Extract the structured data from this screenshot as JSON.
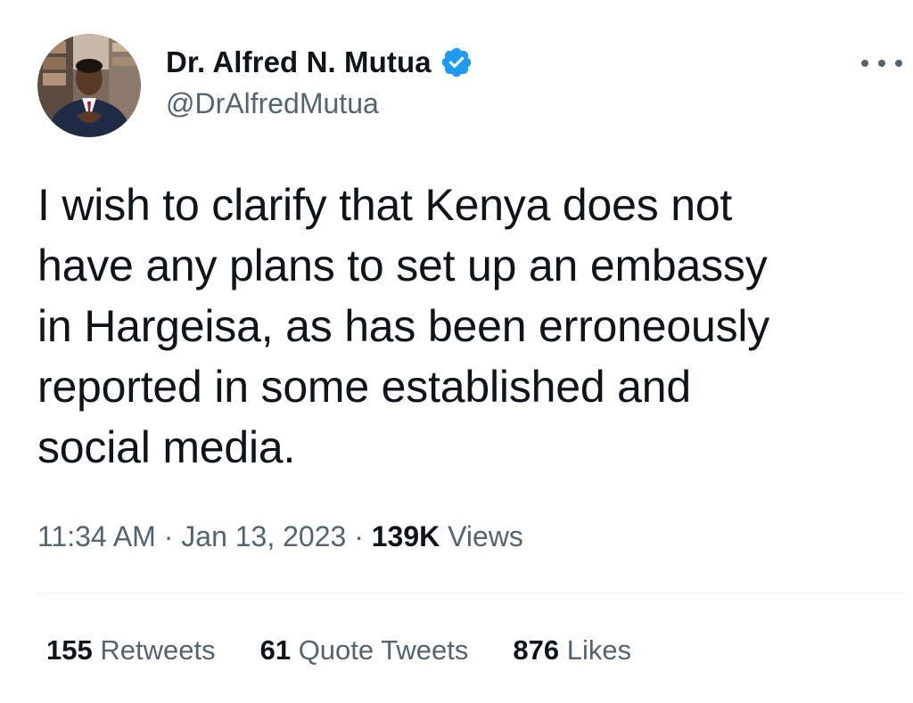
{
  "author": {
    "display_name": "Dr. Alfred N. Mutua",
    "handle": "@DrAlfredMutua",
    "verified": true,
    "avatar_icon": "profile-photo-icon"
  },
  "tweet": {
    "text": "I wish to clarify that Kenya does not\nhave any plans to set up an embassy\nin Hargeisa, as has been erroneously\nreported in some established and\nsocial media."
  },
  "meta": {
    "time": "11:34 AM",
    "date": "Jan 13, 2023",
    "separator": "·",
    "views_count": "139K",
    "views_label": "Views"
  },
  "stats": {
    "retweets_count": "155",
    "retweets_label": "Retweets",
    "quotes_count": "61",
    "quotes_label": "Quote Tweets",
    "likes_count": "876",
    "likes_label": "Likes"
  },
  "colors": {
    "verified_blue": "#1d9bf0",
    "secondary_text": "#536471",
    "primary_text": "#0f1419",
    "divider": "#eff3f4"
  }
}
